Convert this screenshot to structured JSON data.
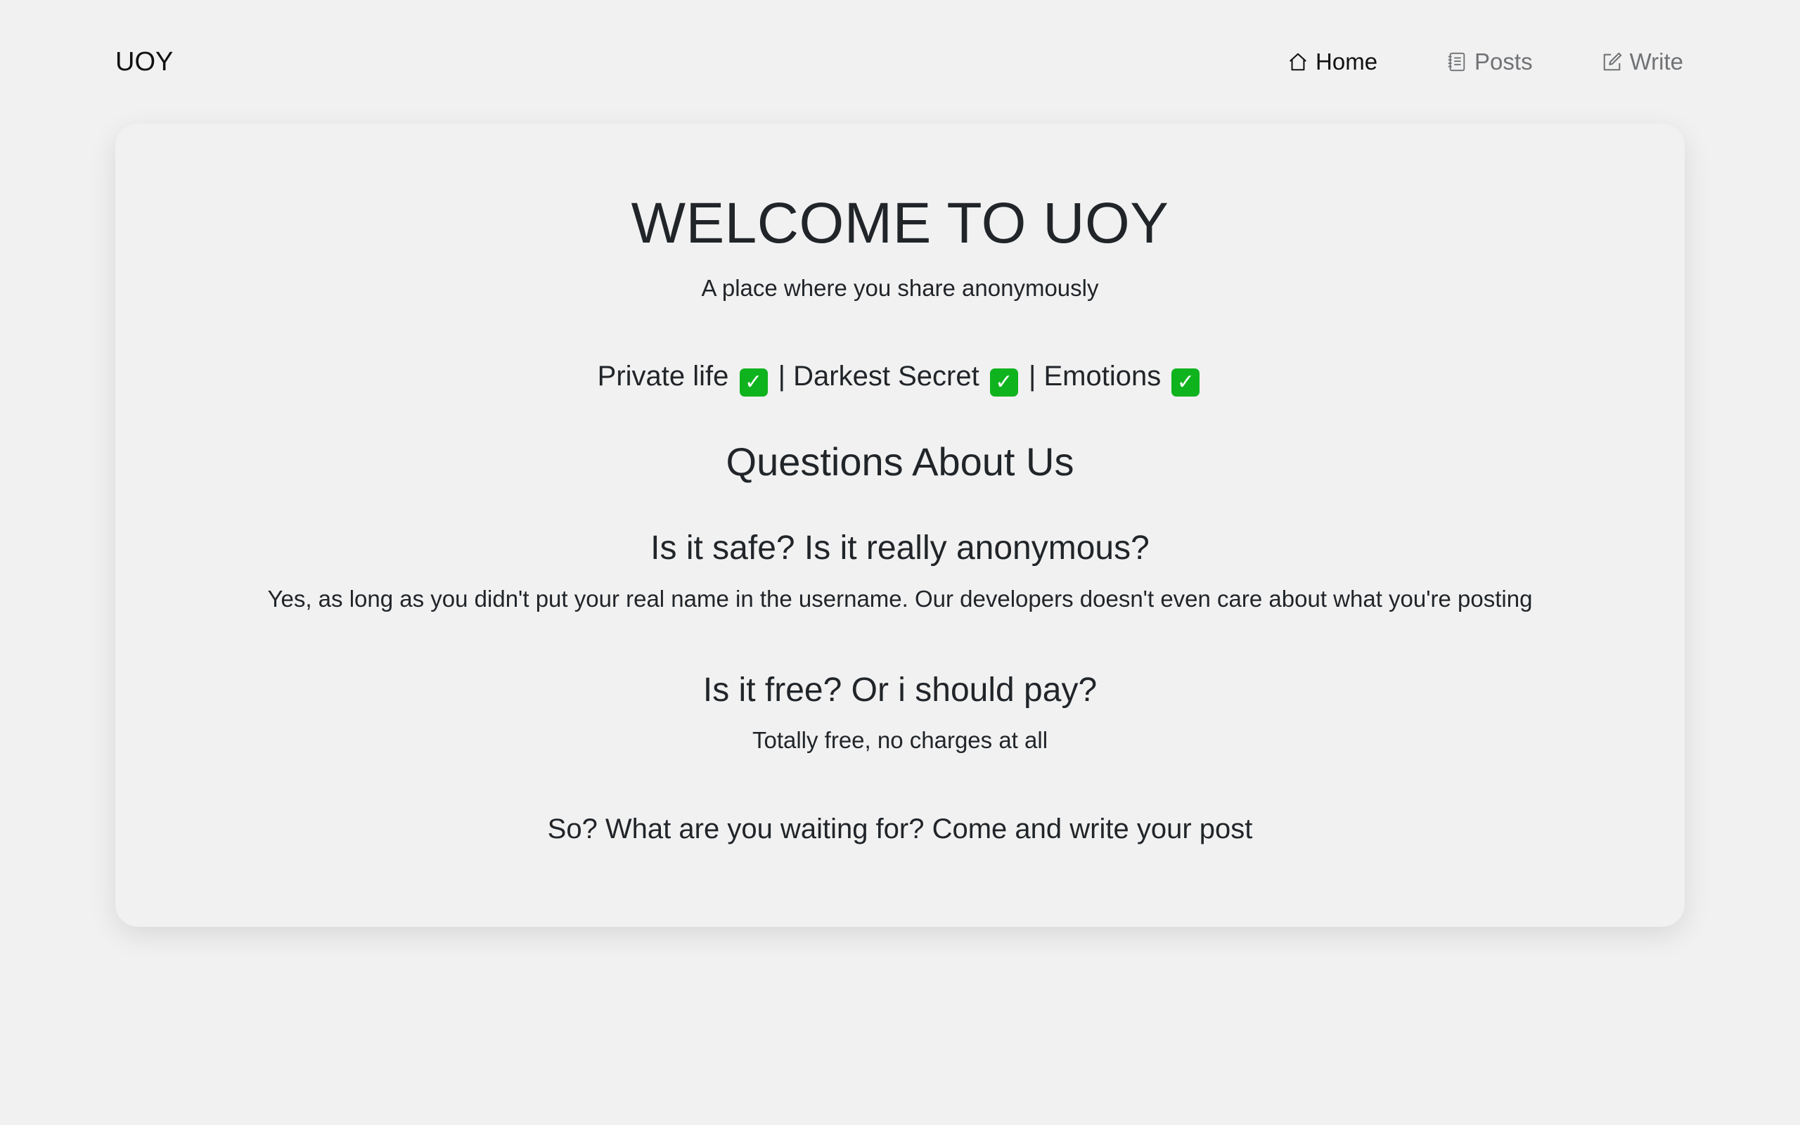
{
  "navbar": {
    "brand": "UOY",
    "links": [
      {
        "label": "Home",
        "icon": "house-icon",
        "active": true
      },
      {
        "label": "Posts",
        "icon": "journal-icon",
        "active": false
      },
      {
        "label": "Write",
        "icon": "pencil-square-icon",
        "active": false
      }
    ]
  },
  "hero": {
    "title": "WELCOME TO UOY",
    "subtitle": "A place where you share anonymously"
  },
  "features": {
    "items": [
      "Private life",
      "Darkest Secret",
      "Emotions"
    ],
    "separator": "|",
    "check_icon": "check-mark-button-icon",
    "check_color": "#0fb31e"
  },
  "faq": {
    "title": "Questions About Us",
    "items": [
      {
        "question": "Is it safe? Is it really anonymous?",
        "answer": "Yes, as long as you didn't put your real name in the username. Our developers doesn't even care about what you're posting"
      },
      {
        "question": "Is it free? Or i should pay?",
        "answer": "Totally free, no charges at all"
      }
    ]
  },
  "cta": "So? What are you waiting for? Come and write your post",
  "colors": {
    "background": "#f1f1f1",
    "text": "#212529",
    "nav_inactive": "#707275"
  }
}
